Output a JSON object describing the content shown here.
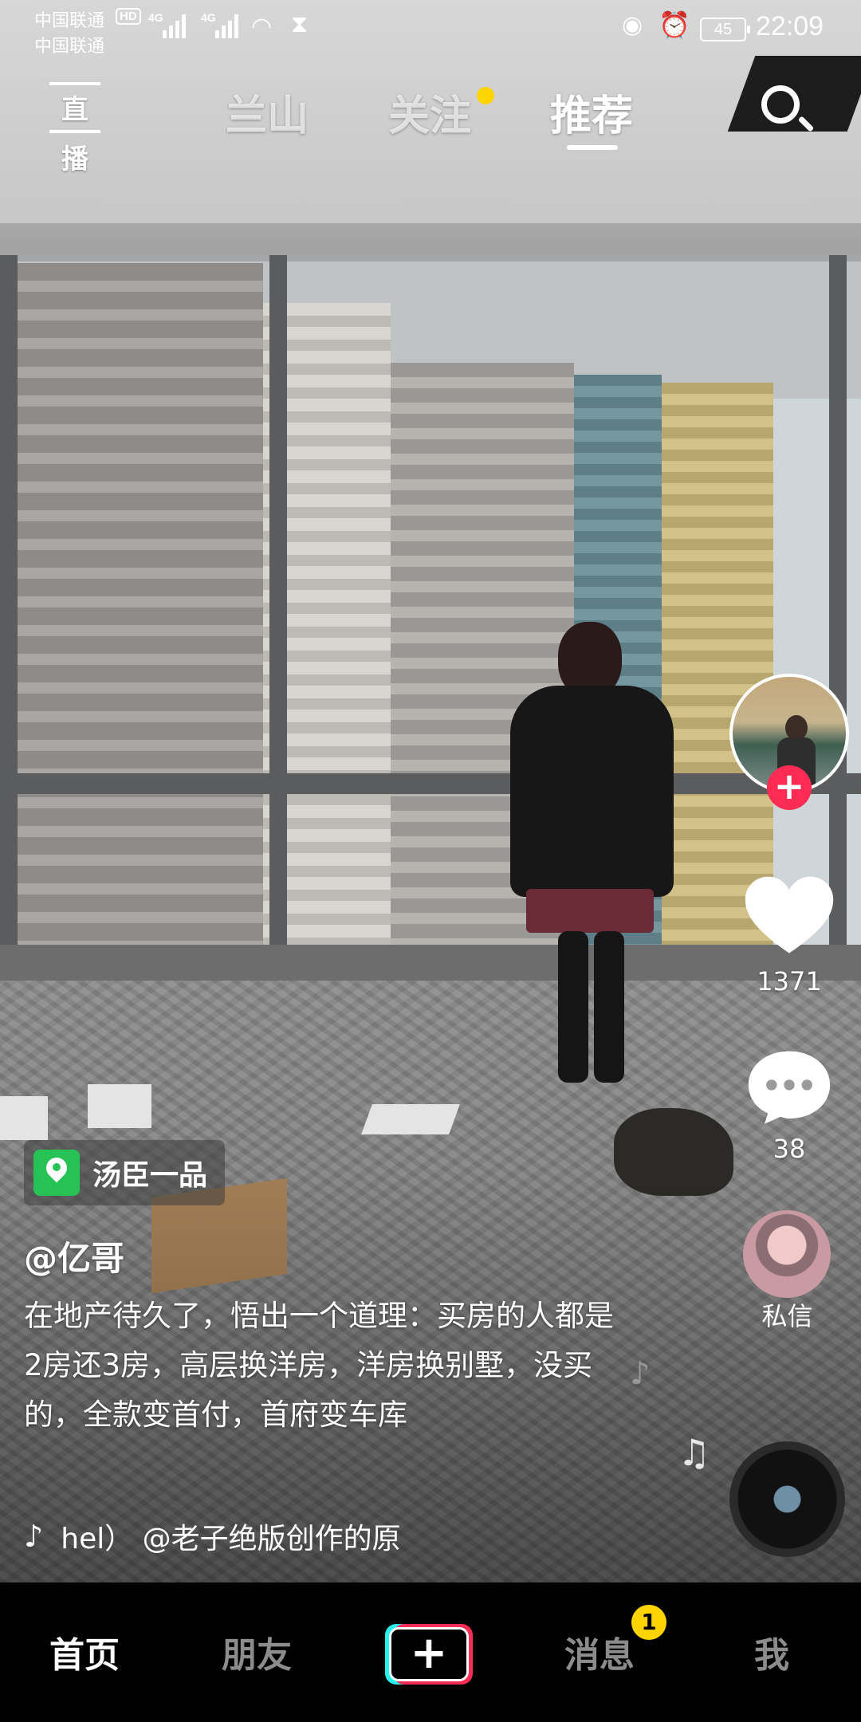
{
  "status_bar": {
    "carrier1": "中国联通",
    "carrier2": "中国联通",
    "hd": "HD",
    "net1": "4G",
    "net2": "4G",
    "battery": "45",
    "time": "22:09"
  },
  "top_nav": {
    "live_label": "直播",
    "tabs": [
      "兰山",
      "关注",
      "推荐"
    ],
    "active_tab": "推荐"
  },
  "video": {
    "location": "汤臣一品",
    "author": "@亿哥",
    "caption": "在地产待久了，悟出一个道理：买房的人都是2房还3房，高层换洋房，洋房换别墅，没买的，全款变首付，首府变车库",
    "music": "hel）     @老子绝版创作的原"
  },
  "actions": {
    "likes": "1371",
    "comments": "38",
    "dm_label": "私信"
  },
  "bottom_nav": {
    "home": "首页",
    "friends": "朋友",
    "plus": "+",
    "messages": "消息",
    "messages_badge": "1",
    "me": "我"
  },
  "colors": {
    "accent_red": "#fe2c55",
    "accent_cyan": "#25f4ee",
    "badge_yellow": "#ffd400",
    "poi_green": "#27c255"
  }
}
